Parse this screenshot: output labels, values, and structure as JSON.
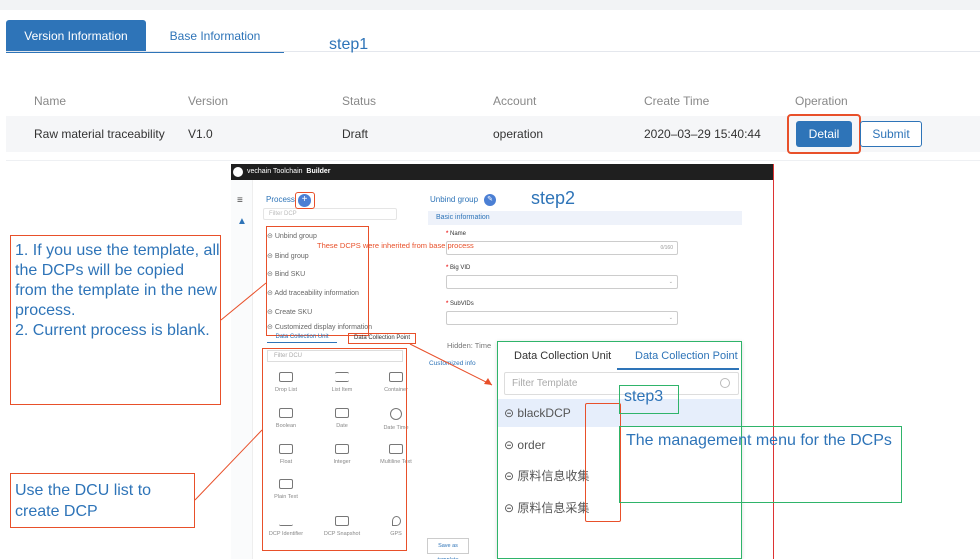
{
  "tabs": {
    "version": "Version Information",
    "base": "Base Information"
  },
  "step1": "step1",
  "table": {
    "headers": [
      "Name",
      "Version",
      "Status",
      "Account",
      "Create Time",
      "Operation"
    ],
    "row": {
      "name": "Raw material traceability",
      "version": "V1.0",
      "status": "Draft",
      "account": "operation",
      "create_time": "2020–03–29 15:40:44"
    },
    "detail": "Detail",
    "submit": "Submit"
  },
  "builder": {
    "brand": "vechain Toolchain",
    "builder_label": "Builder",
    "process": "Process",
    "filter_dcp": "Filter DCP",
    "process_items": [
      "Unbind group",
      "Bind group",
      "Bind SKU",
      "Add traceability information",
      "Create SKU",
      "Customized display information"
    ],
    "inherited_note": "These DCPS were inherited from base process",
    "tab_dcu": "Data Collection Unit",
    "tab_dcp": "Data Collection Point",
    "filter_dcu": "Filter DCU",
    "dcu_items": [
      "Drop List",
      "List Item",
      "Container",
      "Boolean",
      "Date",
      "Date Time",
      "Float",
      "Integer",
      "Multiline Text",
      "Plain Text",
      "",
      "",
      "DCP Identifier",
      "DCP Snapshot",
      "GPS"
    ],
    "unbind_title": "Unbind group",
    "basic_info": "Basic information",
    "name_label": "Name",
    "name_count": "0/160",
    "bigvid_label": "Big VID",
    "subvids_label": "SubVIDs",
    "hidden_label": "Hidden: Time",
    "customized": "Customized info",
    "save_template": "Save as template"
  },
  "step2": "step2",
  "zoom": {
    "tab_dcu": "Data Collection Unit",
    "tab_dcp": "Data Collection Point",
    "filter": "Filter Template",
    "items": [
      "blackDCP",
      "order",
      "原料信息收集",
      "原料信息采集"
    ]
  },
  "step3": "step3",
  "management_note": "The management menu for the DCPs",
  "note1": "1. If you use the template, all the DCPs will be copied from the template in the new process.\n2. Current process is blank.",
  "note2": "Use the DCU list to create DCP",
  "colors": {
    "primary": "#2e74b8",
    "highlight": "#e8502a",
    "annotation_green": "#2fb46a"
  }
}
